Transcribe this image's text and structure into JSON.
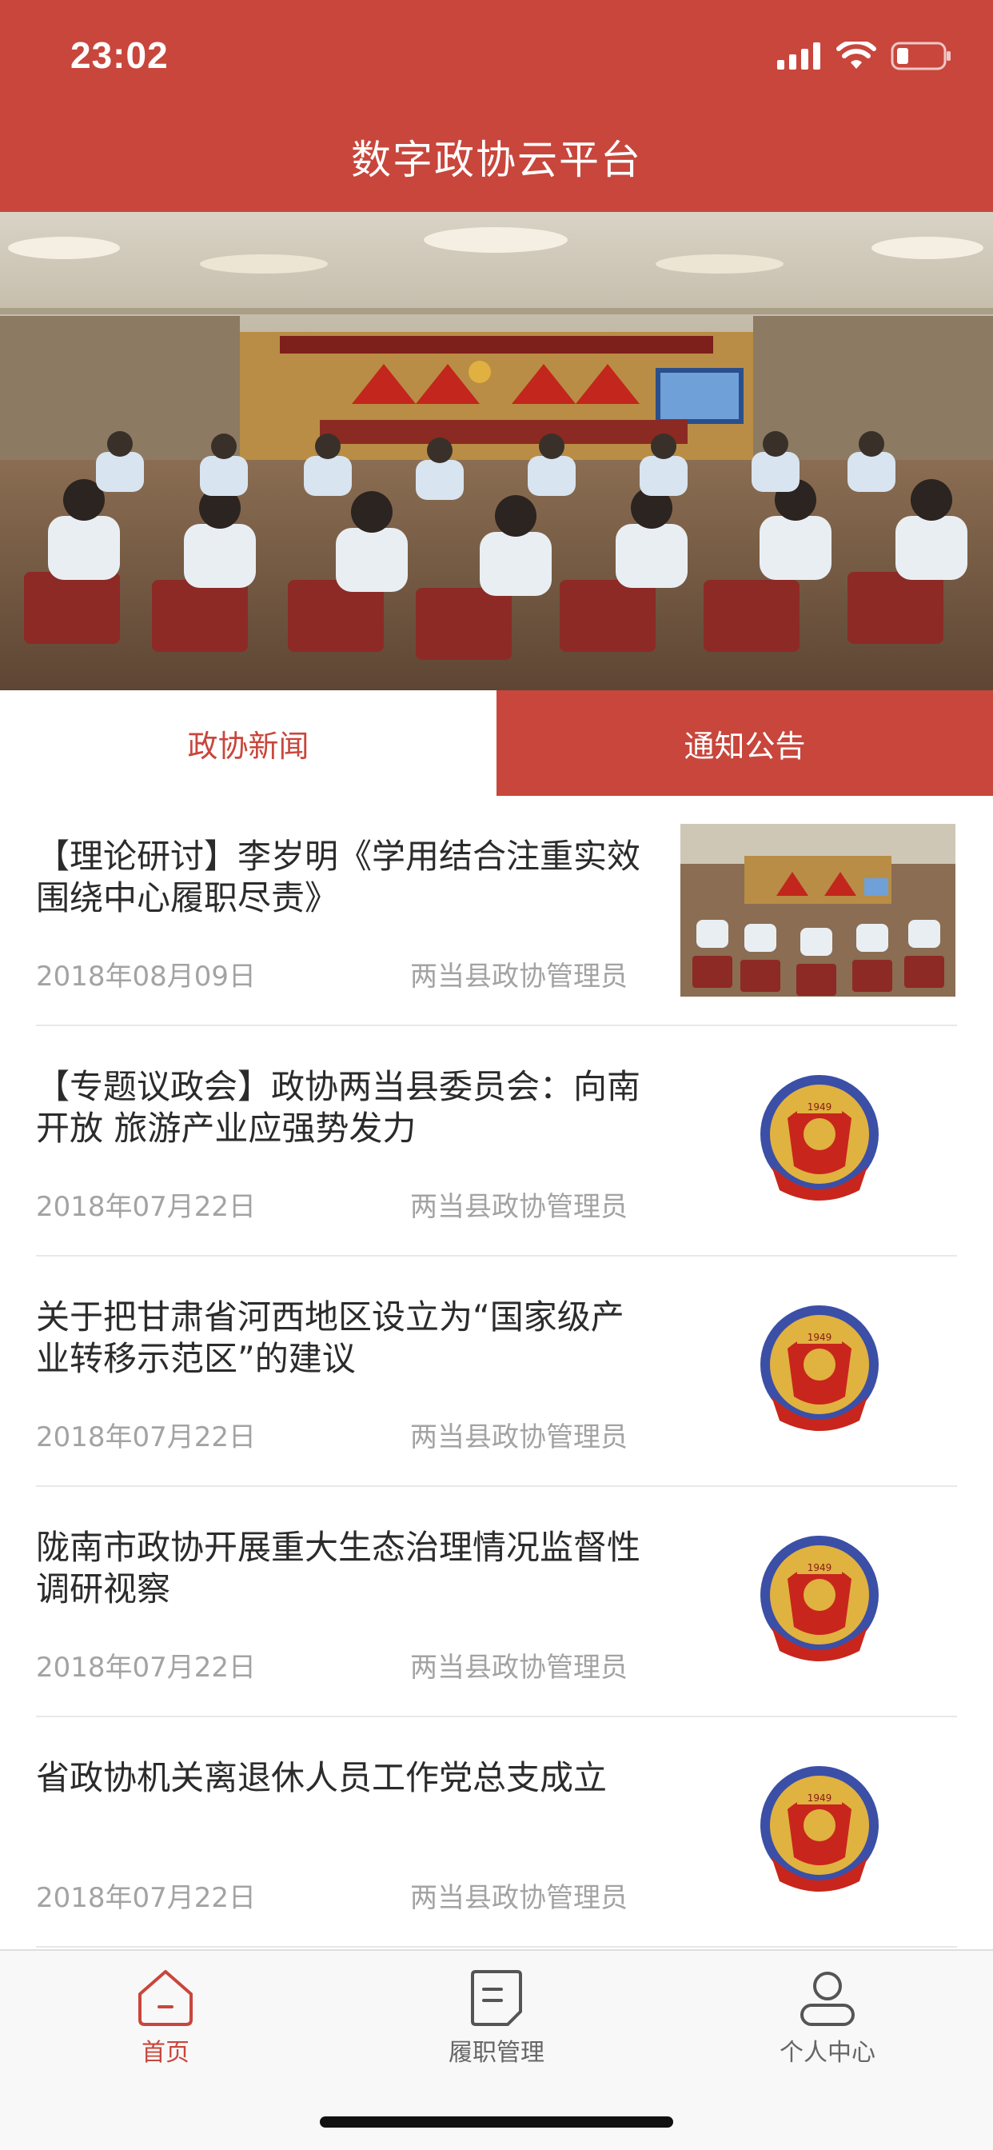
{
  "status_bar": {
    "time": "23:02"
  },
  "header": {
    "title": "数字政协云平台"
  },
  "tabs": [
    {
      "label": "政协新闻",
      "active": true
    },
    {
      "label": "通知公告",
      "active": false
    }
  ],
  "news": [
    {
      "title": "【理论研讨】李岁明《学用结合注重实效 围绕中心履职尽责》",
      "date": "2018年08月09日",
      "author": "两当县政协管理员",
      "thumb": "meeting-photo"
    },
    {
      "title": "【专题议政会】政协两当县委员会：向南开放 旅游产业应强势发力",
      "date": "2018年07月22日",
      "author": "两当县政协管理员",
      "thumb": "cppcc-emblem"
    },
    {
      "title": "关于把甘肃省河西地区设立为“国家级产业转移示范区”的建议",
      "date": "2018年07月22日",
      "author": "两当县政协管理员",
      "thumb": "cppcc-emblem"
    },
    {
      "title": "陇南市政协开展重大生态治理情况监督性调研视察",
      "date": "2018年07月22日",
      "author": "两当县政协管理员",
      "thumb": "cppcc-emblem"
    },
    {
      "title": "省政协机关离退休人员工作党总支成立",
      "date": "2018年07月22日",
      "author": "两当县政协管理员",
      "thumb": "cppcc-emblem"
    }
  ],
  "emblem": {
    "year": "1949"
  },
  "tabbar": [
    {
      "label": "首页",
      "icon": "home-icon",
      "active": true
    },
    {
      "label": "履职管理",
      "icon": "document-icon",
      "active": false
    },
    {
      "label": "个人中心",
      "icon": "user-icon",
      "active": false
    }
  ],
  "colors": {
    "brand_red": "#c8463c",
    "text_dark": "#2b2b2b",
    "text_gray": "#a3a3a3",
    "tab_inactive": "#666666"
  }
}
